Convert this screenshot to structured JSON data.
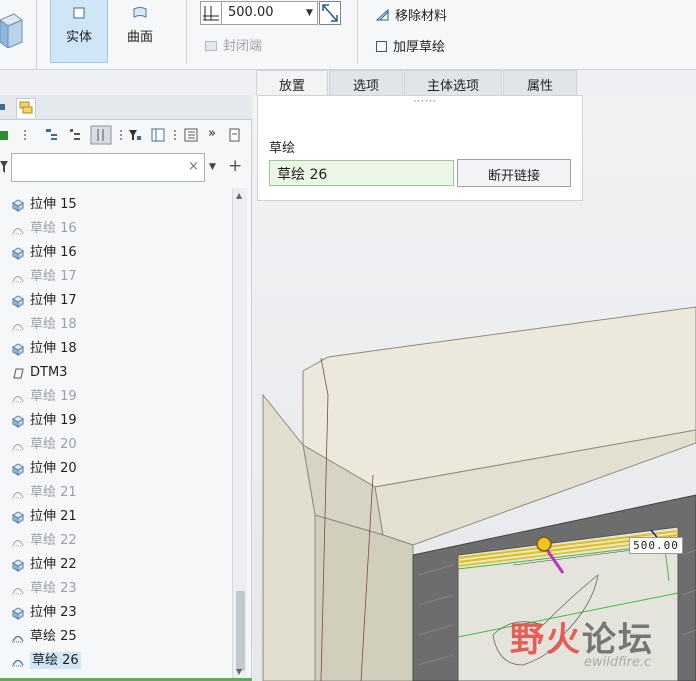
{
  "ribbon": {
    "solid_label": "实体",
    "surface_label": "曲面",
    "depth_value": "500.00",
    "cap_ends_label": "封闭端",
    "remove_material_label": "移除材料",
    "thicken_sketch_label": "加厚草绘"
  },
  "tabs": [
    {
      "label": "放置",
      "active": true
    },
    {
      "label": "选项",
      "active": false
    },
    {
      "label": "主体选项",
      "active": false
    },
    {
      "label": "属性",
      "active": false
    }
  ],
  "placement": {
    "sketch_label": "草绘",
    "sketch_value": "草绘 26",
    "unlink_label": "断开链接"
  },
  "search": {
    "value": ""
  },
  "tree": {
    "items": [
      {
        "label": "拉伸 15",
        "type": "extrude"
      },
      {
        "label": "草绘 16",
        "type": "sketch"
      },
      {
        "label": "拉伸 16",
        "type": "extrude"
      },
      {
        "label": "草绘 17",
        "type": "sketch"
      },
      {
        "label": "拉伸 17",
        "type": "extrude"
      },
      {
        "label": "草绘 18",
        "type": "sketch"
      },
      {
        "label": "拉伸 18",
        "type": "extrude"
      },
      {
        "label": "DTM3",
        "type": "datum-plane"
      },
      {
        "label": "草绘 19",
        "type": "sketch"
      },
      {
        "label": "拉伸 19",
        "type": "extrude"
      },
      {
        "label": "草绘 20",
        "type": "sketch"
      },
      {
        "label": "拉伸 20",
        "type": "extrude"
      },
      {
        "label": "草绘 21",
        "type": "sketch"
      },
      {
        "label": "拉伸 21",
        "type": "extrude"
      },
      {
        "label": "草绘 22",
        "type": "sketch"
      },
      {
        "label": "拉伸 22",
        "type": "extrude"
      },
      {
        "label": "草绘 23",
        "type": "sketch"
      },
      {
        "label": "拉伸 23",
        "type": "extrude"
      },
      {
        "label": "草绘 25",
        "type": "sketch-active"
      },
      {
        "label": "草绘 26",
        "type": "sketch-selected"
      }
    ]
  },
  "viewport": {
    "dimension_value": "500.00",
    "watermark_part1": "野火",
    "watermark_part2": "论坛",
    "watermark_url": "ewildfire.c"
  },
  "colors": {
    "selection": "#cfe6f7",
    "sketch_field": "#eaf7e4",
    "model_face": "#ece9dc",
    "model_edge": "#7a4a4a"
  }
}
